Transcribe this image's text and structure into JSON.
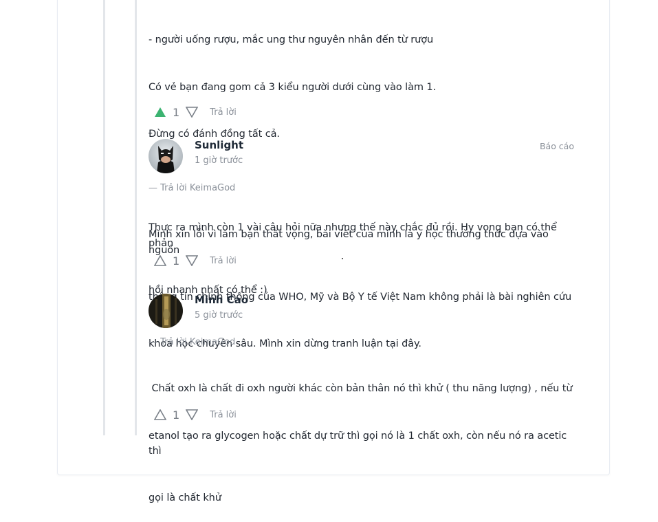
{
  "top_comment": {
    "lines": [
      "- người uống rượu, mắc ung thư nguyên nhân đến từ rượu",
      "Có vẻ bạn đang gom cả 3 kiểu người dưới cùng vào làm 1.",
      "Đừng có đánh đồng tất cả.",
      "",
      "Thực ra mình còn 1 vài câu hỏi nữa nhưng thế này chắc đủ rồi. Hy vọng bạn có thể phản",
      "hồi nhanh nhất có thể :)"
    ],
    "vote_count": "1",
    "upvoted": true,
    "reply_label": "Trả lời",
    "colors": {
      "upvote_active": "#3cb371"
    }
  },
  "replies": [
    {
      "author": "Sunlight",
      "time": "1 giờ trước",
      "report_label": "Báo cáo",
      "avatar_icon": "batman-avatar",
      "reply_to": "— Trả lời KeimaGod",
      "lines": [
        "Mình xin lỗi vì làm bạn thất vọng, bài viết của mình là y học thường thức dựa vào nguồn",
        "thông tin chính thống của WHO, Mỹ và Bộ Y tế Việt Nam không phải là bài nghiên cứu",
        "khoa học chuyên sâu. Mình xin dừng tranh luận tại đây."
      ],
      "vote_count": "1",
      "reply_label": "Trả lời"
    },
    {
      "author": "Minh Cao",
      "time": "5 giờ trước",
      "avatar_icon": "user-photo-avatar",
      "reply_to": "— Trả lời KeimaGod",
      "lines": [
        " Chất oxh là chất đi oxh người khác còn bản thân nó thì khử ( thu năng lượng) , nếu từ",
        "etanol tạo ra glycogen hoặc chất dự trữ thì gọi nó là 1 chất oxh, còn nếu nó ra acetic thì",
        "gọi là chất khử"
      ],
      "vote_count": "1",
      "reply_label": "Trả lời"
    }
  ]
}
